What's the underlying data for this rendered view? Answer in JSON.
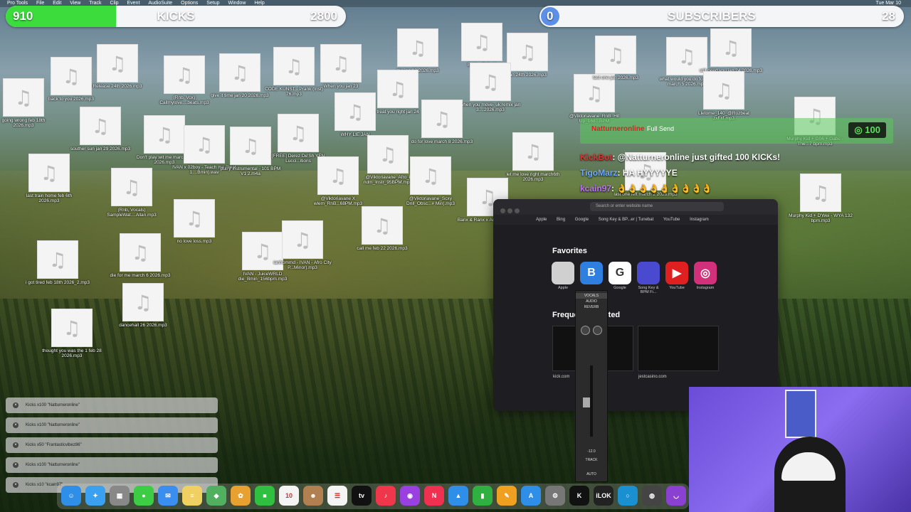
{
  "menubar": {
    "items": [
      "Pro Tools",
      "File",
      "Edit",
      "View",
      "Track",
      "Clip",
      "Event",
      "AudioSuite",
      "Options",
      "Setup",
      "Window",
      "Help"
    ],
    "time": "Tue Mar 10"
  },
  "kicks_goal": {
    "left": "910",
    "label": "KICKS",
    "right": "2800",
    "progress": 0.325,
    "color": "#3ddc3d"
  },
  "subs_goal": {
    "left": "0",
    "label": "SUBSCRIBERS",
    "right": "28",
    "progress": 0.0,
    "color": "#5aa0ff"
  },
  "icon_glyph": "♫",
  "desktop_files": [
    {
      "name": "going wrong feb 18th 2026.mp3"
    },
    {
      "name": "back to you 2026.mp3"
    },
    {
      "name": "Release 24th 2026.mp3"
    },
    {
      "name": "(Rnb, Vox) Callmylove....beats.mp3"
    },
    {
      "name": "give it time jan 20 2026.mp3"
    },
    {
      "name": "CODE KUNST - Prank (Inst) 76.mp3"
    },
    {
      "name": "When you jan 23"
    },
    {
      "name": "me jan 18 2026.mp3"
    },
    {
      "name": "Bobby Safe H"
    },
    {
      "name": "jan 24th 2026.mp3"
    },
    {
      "name": "souther sun jan 29 2026.mp3"
    },
    {
      "name": "Don't play wit me march 10 2026.mp3"
    },
    {
      "name": "IVAN x 02boy - Teach me (beat 1....Bmin).wav"
    },
    {
      "name": "purry instrumental - 101 BPM V1 2.m4a"
    },
    {
      "name": "[FREE] Derez De'Sh YFN Lucci...itions"
    },
    {
      "name": "WHY LIE JAN"
    },
    {
      "name": "treat you right jan 24"
    },
    {
      "name": "when you move- uk remix jan 3....2026.mp3"
    },
    {
      "name": "do for love march 8 2026.mp3"
    },
    {
      "name": "last train home feb 6th 2026.mp3"
    },
    {
      "name": "(Rnb, Vocals) SampleWat....Allan.mp3"
    },
    {
      "name": "no love loss.mp3"
    },
    {
      "name": "@Viktoriavane_Afro_i ndm_Instr_95BPM.mp3"
    },
    {
      "name": "@Viktoriavane_Scxy Drill_Obsc...# Min).mp3"
    },
    {
      "name": "@Viktoriavane X wlem_RnB...68PM.mp3"
    },
    {
      "name": "Banx & Ranx x Advice - 105 t"
    },
    {
      "name": "let me love right march6th 2026.mp3"
    },
    {
      "name": "@Viktoriavane_RnB_Hit Up_168...BPM"
    },
    {
      "name": "i got tired feb 18th 2026_2.mp3"
    },
    {
      "name": "die for me march 6 2026.mp3"
    },
    {
      "name": "IVAN - JuiceWRLD die_Bmin_156bpm.mp3"
    },
    {
      "name": "ianfrommd - IVAN - Afro City P...Minor).mp3"
    },
    {
      "name": "call me feb 22 2026.mp3"
    },
    {
      "name": "dancehall 26 2026.mp3"
    },
    {
      "name": "thought you was the 1 feb 28 2026.mp3"
    },
    {
      "name": "what would you do for love march 5 2026.mp3"
    },
    {
      "name": "still need you jan 24 2026.mp3"
    },
    {
      "name": "last one jan 2026.mp3"
    },
    {
      "name": "Lletome_140_@Rozbeat zxFxf.mp3"
    },
    {
      "name": "Murphy Kid + G06 + Gabc - The...7 bpm.mp3"
    },
    {
      "name": "last one left march 2 2026.mp3"
    },
    {
      "name": "Murphy Kid + D'Wei - WYA 132 bpm.mp3"
    }
  ],
  "gift_banner": {
    "user": "Natturneronline",
    "action": "Full Send",
    "amount": "100"
  },
  "chat": [
    {
      "user": "KickBot",
      "user_color": "#e03030",
      "text": ": @Natturneronline just gifted 100 KICKs!"
    },
    {
      "user": "TigoMarz",
      "user_color": "#6fa8ff",
      "text": ": HA HYYYYYE"
    },
    {
      "user": "kcain97",
      "user_color": "#c070ff",
      "text": ": 👌👌👌👌👌👌👌👌👌"
    }
  ],
  "browser": {
    "url_placeholder": "Search or enter website name",
    "bookmarks": [
      "Apple",
      "Bing",
      "Google",
      "Song Key & BP...er | Tunebat",
      "YouTube",
      "Instagram"
    ],
    "favorites_title": "Favorites",
    "favorites": [
      {
        "label": "Apple",
        "glyph": "",
        "color": "#d0d0d0"
      },
      {
        "label": "",
        "glyph": "B",
        "color": "#2f7fe0"
      },
      {
        "label": "Google",
        "glyph": "G",
        "color": "#ffffff"
      },
      {
        "label": "Song Key & BPM Fi...",
        "glyph": "",
        "color": "#4a4ad0"
      },
      {
        "label": "YouTube",
        "glyph": "▶",
        "color": "#e02020"
      },
      {
        "label": "Instagram",
        "glyph": "◎",
        "color": "#d2307a"
      }
    ],
    "frequent_title": "Frequently Visited",
    "frequent": [
      {
        "label": "kick.com"
      },
      {
        "label": "jestcasino.com"
      }
    ]
  },
  "mixer": {
    "insert": "VOCALS",
    "labels": [
      "AUDIO",
      "REVERB"
    ],
    "volume": "-12.0",
    "track": "TRACK",
    "auto": "AUTO"
  },
  "notifications": [
    {
      "text": "Kicks x100 \"Natturneronline\""
    },
    {
      "text": "Kicks x100 \"Natturneronline\""
    },
    {
      "text": "Kicks x50 \"Frantasticvibez86\""
    },
    {
      "text": "Kicks x100 \"Natturneronline\""
    },
    {
      "text": "Kicks x10 \"kcain97\""
    }
  ],
  "dock": [
    {
      "name": "finder-icon",
      "glyph": "☺",
      "color": "#2f8fe8"
    },
    {
      "name": "safari-icon",
      "glyph": "✦",
      "color": "#3aa0f0"
    },
    {
      "name": "launchpad-icon",
      "glyph": "▦",
      "color": "#888"
    },
    {
      "name": "messages-icon",
      "glyph": "●",
      "color": "#3ccd45"
    },
    {
      "name": "mail-icon",
      "glyph": "✉",
      "color": "#3a8ef0"
    },
    {
      "name": "notes-icon",
      "glyph": "≡",
      "color": "#f0d060"
    },
    {
      "name": "maps-icon",
      "glyph": "◆",
      "color": "#50b060"
    },
    {
      "name": "photos-icon",
      "glyph": "✿",
      "color": "#e8a030"
    },
    {
      "name": "facetime-icon",
      "glyph": "■",
      "color": "#30c040"
    },
    {
      "name": "calendar-icon",
      "glyph": "10",
      "color": "#f4f4f4"
    },
    {
      "name": "contacts-icon",
      "glyph": "☻",
      "color": "#b08050"
    },
    {
      "name": "reminders-icon",
      "glyph": "☰",
      "color": "#f4f4f4"
    },
    {
      "name": "tv-icon",
      "glyph": "tv",
      "color": "#111"
    },
    {
      "name": "music-icon",
      "glyph": "♪",
      "color": "#f0364a"
    },
    {
      "name": "podcasts-icon",
      "glyph": "◉",
      "color": "#9a40e0"
    },
    {
      "name": "news-icon",
      "glyph": "N",
      "color": "#f03050"
    },
    {
      "name": "keynote-icon",
      "glyph": "▲",
      "color": "#2f8fe8"
    },
    {
      "name": "numbers-icon",
      "glyph": "▮",
      "color": "#30b040"
    },
    {
      "name": "pages-icon",
      "glyph": "✎",
      "color": "#f0a020"
    },
    {
      "name": "appstore-icon",
      "glyph": "A",
      "color": "#2f8fe8"
    },
    {
      "name": "settings-icon",
      "glyph": "⚙",
      "color": "#777"
    },
    {
      "name": "kick-icon",
      "glyph": "K",
      "color": "#111"
    },
    {
      "name": "ilok-icon",
      "glyph": "iLOK",
      "color": "#222"
    },
    {
      "name": "circle-app-icon",
      "glyph": "○",
      "color": "#1a90d0"
    },
    {
      "name": "mixer-app-icon",
      "glyph": "◍",
      "color": "#444"
    },
    {
      "name": "protools-icon",
      "glyph": "◡",
      "color": "#8a40d0"
    }
  ]
}
